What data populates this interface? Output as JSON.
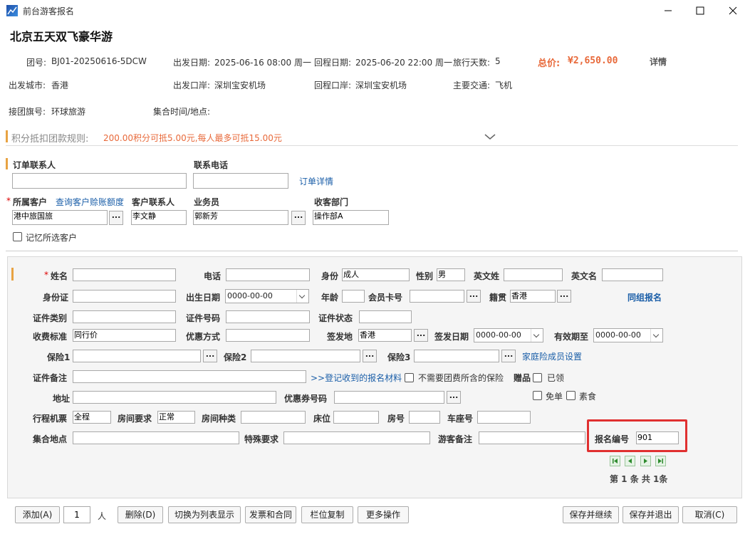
{
  "window": {
    "title": "前台游客报名"
  },
  "page_title": "北京五天双飞豪华游",
  "info": {
    "group_no_label": "团号:",
    "group_no": "BJ01-20250616-5DCW",
    "depart_date_label": "出发日期:",
    "depart_date": "2025-06-16 08:00 周一",
    "return_date_label": "回程日期:",
    "return_date": "2025-06-20 22:00 周一",
    "days_label": "旅行天数:",
    "days": "5",
    "total_label": "总价:",
    "total": "¥2,650.00",
    "detail_link": "详情",
    "depart_city_label": "出发城市:",
    "depart_city": "香港",
    "depart_port_label": "出发口岸:",
    "depart_port": "深圳宝安机场",
    "return_port_label": "回程口岸:",
    "return_port": "深圳宝安机场",
    "transport_label": "主要交通:",
    "transport": "飞机",
    "flag_label": "接团旗号:",
    "flag": "环球旅游",
    "meeting_label": "集合时间/地点:",
    "meeting": ""
  },
  "points": {
    "title": "积分抵扣团款规则:",
    "rule": "200.00积分可抵5.00元,每人最多可抵15.00元"
  },
  "order": {
    "contact_label": "订单联系人",
    "contact_value": "",
    "phone_label": "联系电话",
    "phone_value": "",
    "order_detail_link": "订单详情",
    "customer_label": "所属客户",
    "credit_link": "查询客户赊账额度",
    "customer_value": "港中旅国旅",
    "customer_contact_label": "客户联系人",
    "customer_contact_value": "李文静",
    "salesman_label": "业务员",
    "salesman_value": "郭新芳",
    "dept_label": "收客部门",
    "dept_value": "操作部A",
    "remember_label": "记忆所选客户"
  },
  "form": {
    "name_label": "姓名",
    "name": "",
    "phone_label": "电话",
    "phone": "",
    "identity_label": "身份",
    "identity": "成人",
    "gender_label": "性别",
    "gender": "男",
    "en_surname_label": "英文姓",
    "en_surname": "",
    "en_name_label": "英文名",
    "en_name": "",
    "idcard_label": "身份证",
    "idcard": "",
    "birth_label": "出生日期",
    "birth": "0000-00-00",
    "age_label": "年龄",
    "age": "",
    "member_label": "会员卡号",
    "member": "",
    "native_label": "籍贯",
    "native": "香港",
    "group_signup_link": "同组报名",
    "doc_type_label": "证件类别",
    "doc_type": "",
    "doc_no_label": "证件号码",
    "doc_no": "",
    "doc_status_label": "证件状态",
    "doc_status": "",
    "fee_label": "收费标准",
    "fee": "同行价",
    "discount_label": "优惠方式",
    "discount": "",
    "issue_place_label": "签发地",
    "issue_place": "香港",
    "issue_date_label": "签发日期",
    "issue_date": "0000-00-00",
    "expiry_label": "有效期至",
    "expiry": "0000-00-00",
    "ins1_label": "保险1",
    "ins1": "",
    "ins2_label": "保险2",
    "ins2": "",
    "ins3_label": "保险3",
    "ins3": "",
    "family_ins_link": "家庭险成员设置",
    "doc_remark_label": "证件备注",
    "doc_remark": "",
    "materials_link": ">>登记收到的报名材料",
    "no_ins_label": "不需要团费所含的保险",
    "gift_label": "赠品",
    "received_label": "已领",
    "address_label": "地址",
    "address": "",
    "coupon_label": "优惠券号码",
    "coupon": "",
    "free_label": "免单",
    "veg_label": "素食",
    "ticket_label": "行程机票",
    "ticket": "全程",
    "room_req_label": "房间要求",
    "room_req": "正常",
    "room_type_label": "房间种类",
    "room_type": "",
    "bed_label": "床位",
    "bed": "",
    "room_no_label": "房号",
    "room_no": "",
    "seat_label": "车座号",
    "seat": "",
    "meet_place_label": "集合地点",
    "meet_place": "",
    "special_label": "特殊要求",
    "special": "",
    "guest_remark_label": "游客备注",
    "guest_remark": "",
    "reg_no_label": "报名编号",
    "reg_no": "901",
    "pager_text": "第 1 条 共 1条"
  },
  "footer": {
    "add": "添加(A)",
    "count": "1",
    "person": "人",
    "delete": "删除(D)",
    "switch_list": "切换为列表显示",
    "invoice": "发票和合同",
    "copy": "栏位复制",
    "more": "更多操作",
    "save_continue": "保存并继续",
    "save_exit": "保存并退出",
    "cancel": "取消(C)"
  },
  "colors": {
    "accent": "#e8a343",
    "price": "#e8693a",
    "link": "#1a5ea8",
    "highlight": "#e03030"
  }
}
